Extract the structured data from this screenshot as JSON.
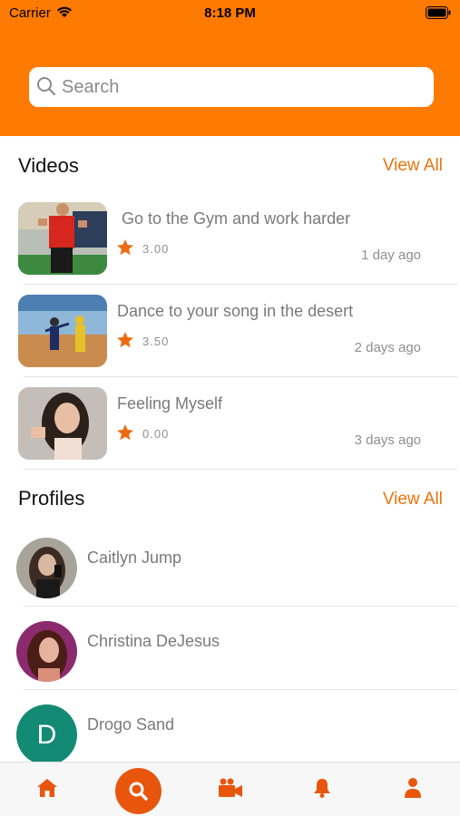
{
  "status_bar": {
    "carrier": "Carrier",
    "time": "8:18 PM"
  },
  "search": {
    "placeholder": "Search"
  },
  "videos": {
    "title": "Videos",
    "view_all": "View All",
    "items": [
      {
        "title": "Go to the Gym and work harder",
        "rating": "3.00",
        "ago": "1 day ago"
      },
      {
        "title": "Dance to your song in the desert",
        "rating": "3.50",
        "ago": "2 days ago"
      },
      {
        "title": "Feeling Myself",
        "rating": "0.00",
        "ago": "3 days ago"
      }
    ]
  },
  "profiles": {
    "title": "Profiles",
    "view_all": "View All",
    "items": [
      {
        "name": "Caitlyn Jump"
      },
      {
        "name": "Christina DeJesus"
      },
      {
        "name": "Drogo Sand",
        "initial": "D"
      }
    ]
  },
  "tab_bar": {
    "items": [
      "home-icon",
      "search-icon",
      "video-camera-icon",
      "bell-icon",
      "person-icon"
    ],
    "active": "search-icon"
  },
  "colors": {
    "accent": "#ff7a00",
    "accent_dark": "#e8560d",
    "link": "#e8740c",
    "avatar_bg": "#138a73"
  }
}
